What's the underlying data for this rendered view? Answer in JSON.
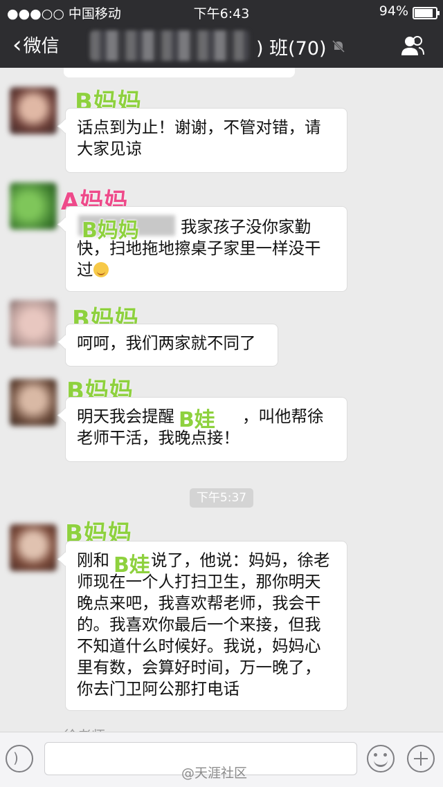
{
  "status_bar": {
    "carrier": "●●●○○ 中国移动",
    "time": "下午6:43",
    "battery": "94%"
  },
  "nav": {
    "back_label": "微信",
    "title_suffix": ")  班(70)",
    "icons": [
      "mute-bell-icon",
      "group-members-icon"
    ]
  },
  "messages": [
    {
      "nick": "B妈妈",
      "text": "话点到为止！谢谢，不管对错，请大家见谅"
    },
    {
      "nick": "A妈妈",
      "overlay": "B妈妈",
      "text": "我家孩子没你家勤快，扫地拖地擦桌子家里一样没干过"
    },
    {
      "nick": "B妈妈",
      "text": "呵呵，我们两家就不同了"
    },
    {
      "nick": "B妈妈",
      "overlay": "B娃",
      "text_before": "明天我会提醒",
      "text_after": "，叫他帮徐老师干活，我晚点接！"
    },
    {
      "nick": "B妈妈",
      "overlay": "B娃",
      "text_before": "刚和",
      "text_after": "说了，他说：妈妈，徐老师现在一个人打扫卫生，那你明天晚点来吧，我喜欢帮老师，我会干的。我喜欢你最后一个来接，但我不知道什么时候好。我说，妈妈心里有数，会算好时间，万一晚了，你去门卫阿公那打电话"
    }
  ],
  "timestamp": "下午5:37",
  "partial_sender": "徐老师",
  "watermark": "@天涯社区",
  "colors": {
    "nav_bg": "#2d2d30",
    "nick_green": "#8ed13e",
    "nick_pink": "#ee4a8a",
    "chat_bg": "#ebebeb"
  }
}
